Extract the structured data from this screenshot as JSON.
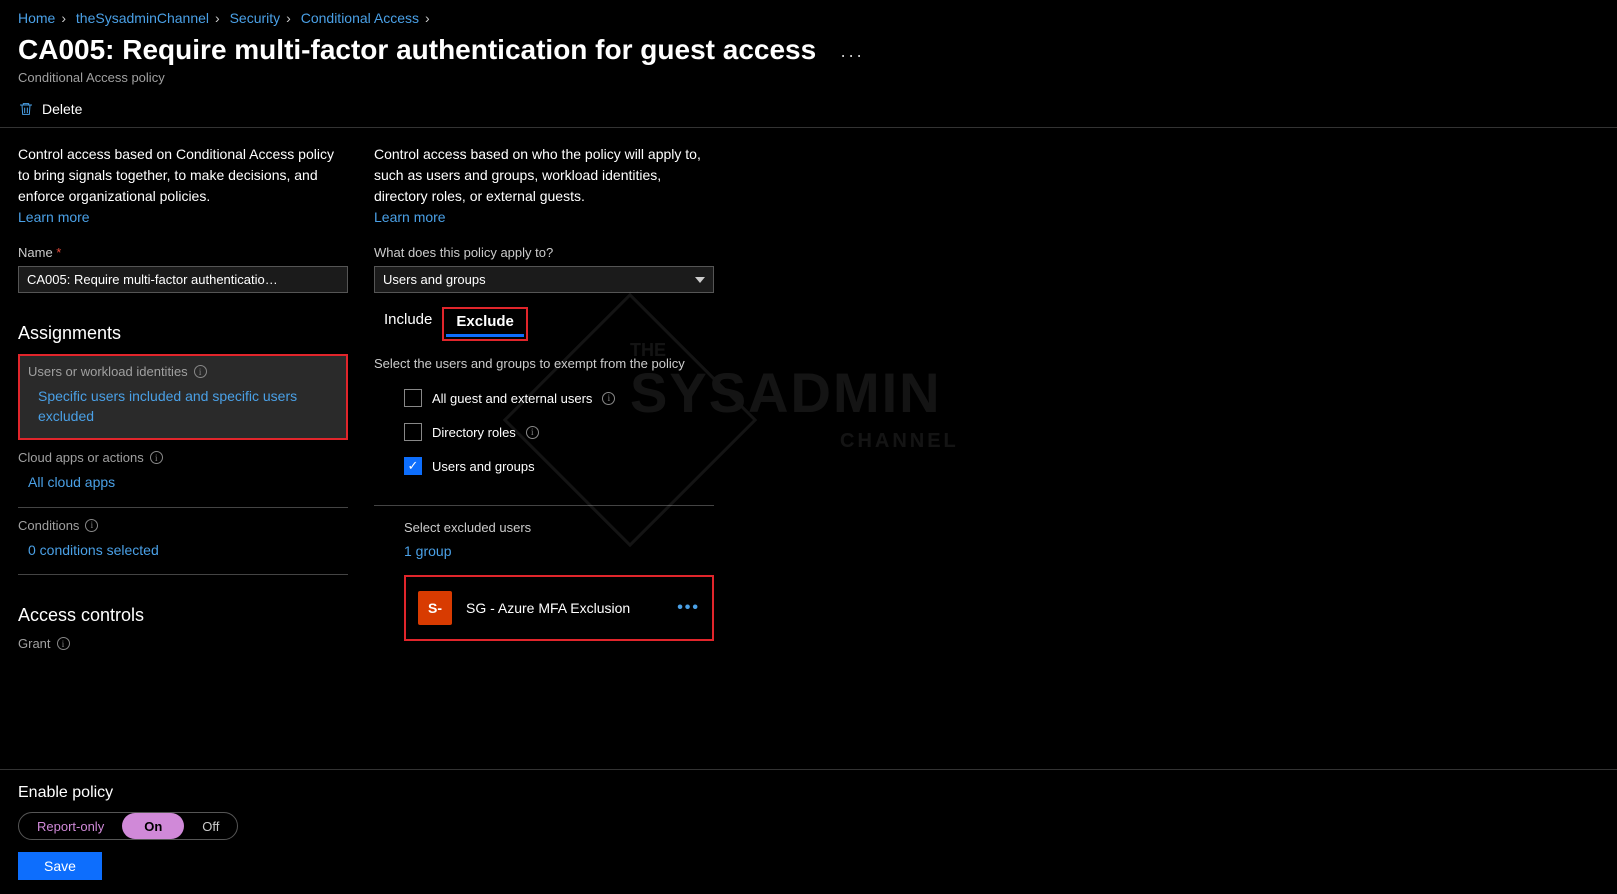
{
  "breadcrumb": {
    "items": [
      "Home",
      "theSysadminChannel",
      "Security",
      "Conditional Access"
    ]
  },
  "header": {
    "title": "CA005: Require multi-factor authentication for guest access",
    "subtitle": "Conditional Access policy",
    "more": "···"
  },
  "toolbar": {
    "delete": "Delete"
  },
  "left": {
    "desc": "Control access based on Conditional Access policy to bring signals together, to make decisions, and enforce organizational policies.",
    "learn": "Learn more",
    "name_label": "Name",
    "name_value": "CA005: Require multi-factor authenticatio…",
    "assignments_title": "Assignments",
    "items": {
      "users": {
        "label": "Users or workload identities",
        "value": "Specific users included and specific users excluded"
      },
      "apps": {
        "label": "Cloud apps or actions",
        "value": "All cloud apps"
      },
      "cond": {
        "label": "Conditions",
        "value": "0 conditions selected"
      }
    },
    "access_title": "Access controls",
    "grant_label": "Grant"
  },
  "right": {
    "desc": "Control access based on who the policy will apply to, such as users and groups, workload identities, directory roles, or external guests.",
    "learn": "Learn more",
    "apply_label": "What does this policy apply to?",
    "apply_value": "Users and groups",
    "tabs": {
      "include": "Include",
      "exclude": "Exclude"
    },
    "exclude_desc": "Select the users and groups to exempt from the policy",
    "checks": {
      "guests": "All guest and external users",
      "roles": "Directory roles",
      "users": "Users and groups"
    },
    "excluded_label": "Select excluded users",
    "group_count": "1 group",
    "group": {
      "avatar": "S-",
      "name": "SG - Azure MFA Exclusion",
      "more": "•••"
    }
  },
  "footer": {
    "title": "Enable policy",
    "toggle": {
      "report": "Report-only",
      "on": "On",
      "off": "Off"
    },
    "save": "Save"
  },
  "watermark": {
    "line1": "THE",
    "line2": "SYSADMIN",
    "line3": "CHANNEL"
  }
}
